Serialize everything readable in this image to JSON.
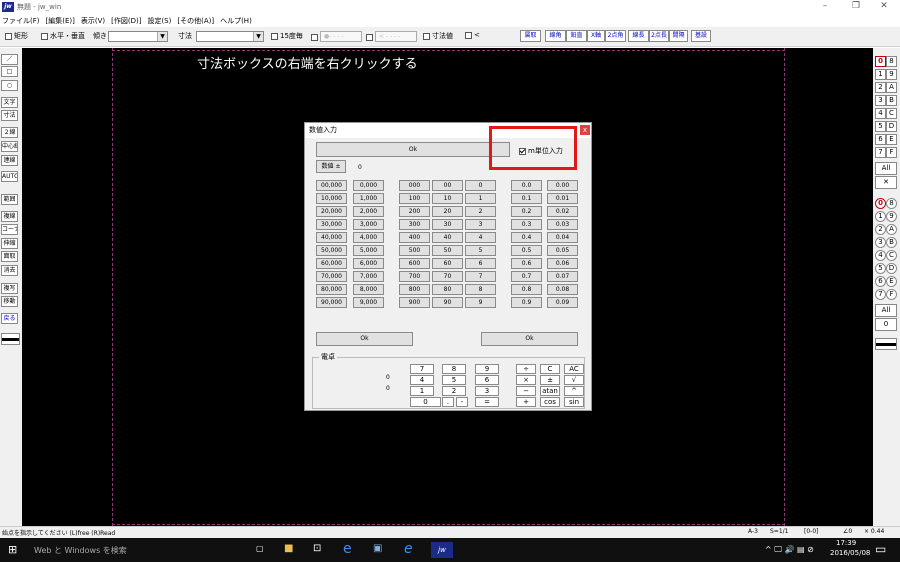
{
  "window": {
    "title": "無題 - jw_win",
    "app_icon": "jw-app-icon",
    "minimize": "–",
    "restore": "❐",
    "close": "✕"
  },
  "menu": [
    "ファイル(F)",
    "[編集(E)]",
    "表示(V)",
    "[作図(D)]",
    "設定(S)",
    "[その他(A)]",
    "ヘルプ(H)"
  ],
  "toolbar": {
    "rect_label": "矩形",
    "horiz_vert_label": "水平・垂直",
    "slope_label": "傾き",
    "slope_value": "",
    "dim_label": "寸法",
    "dim_value": "",
    "deg15_label": "15度毎",
    "linestyle_preview": "●- - - -",
    "arrow_preview": "< - - - -",
    "dimvalue_label": "寸法値",
    "lt_label": "<",
    "buttons": [
      "属取",
      "線角",
      "鉛直",
      "X軸",
      "2点角",
      "線長",
      "2点長",
      "間隔",
      "基設"
    ]
  },
  "left_tools": [
    "／",
    "□",
    "○",
    "文字",
    "寸法",
    "２線",
    "中心線",
    "連線",
    "AUTO",
    "範囲",
    "複線",
    "コーナー",
    "伸縮",
    "面取",
    "消去",
    "複写",
    "移動",
    "戻る"
  ],
  "right_layers": {
    "group1": [
      [
        "0",
        "8"
      ],
      [
        "1",
        "9"
      ],
      [
        "2",
        "A"
      ],
      [
        "3",
        "B"
      ],
      [
        "4",
        "C"
      ],
      [
        "5",
        "D"
      ],
      [
        "6",
        "E"
      ],
      [
        "7",
        "F"
      ]
    ],
    "all1": "All",
    "x1": "✕",
    "group2": [
      [
        "0",
        "8"
      ],
      [
        "1",
        "9"
      ],
      [
        "2",
        "A"
      ],
      [
        "3",
        "B"
      ],
      [
        "4",
        "C"
      ],
      [
        "5",
        "D"
      ],
      [
        "6",
        "E"
      ],
      [
        "7",
        "F"
      ]
    ],
    "all2": "All",
    "zero": "0"
  },
  "canvas": {
    "annotation": "寸法ボックスの右端を右クリックする"
  },
  "dialog": {
    "title": "数値入力",
    "close": "x",
    "ok_top": "Ok",
    "m_unit_label": "m単位入力",
    "m_unit_checked": true,
    "sign_button": "数値 ±",
    "value": "0",
    "col1": [
      "00,000",
      "10,000",
      "20,000",
      "30,000",
      "40,000",
      "50,000",
      "60,000",
      "70,000",
      "80,000",
      "90,000"
    ],
    "col2": [
      "0,000",
      "1,000",
      "2,000",
      "3,000",
      "4,000",
      "5,000",
      "6,000",
      "7,000",
      "8,000",
      "9,000"
    ],
    "col3": [
      "000",
      "100",
      "200",
      "300",
      "400",
      "500",
      "600",
      "700",
      "800",
      "900"
    ],
    "col4": [
      "00",
      "10",
      "20",
      "30",
      "40",
      "50",
      "60",
      "70",
      "80",
      "90"
    ],
    "col5": [
      "0",
      "1",
      "2",
      "3",
      "4",
      "5",
      "6",
      "7",
      "8",
      "9"
    ],
    "col6": [
      "0.0",
      "0.1",
      "0.2",
      "0.3",
      "0.4",
      "0.5",
      "0.6",
      "0.7",
      "0.8",
      "0.9"
    ],
    "col7": [
      "0.00",
      "0.01",
      "0.02",
      "0.03",
      "0.04",
      "0.05",
      "0.06",
      "0.07",
      "0.08",
      "0.09"
    ],
    "ok_left": "Ok",
    "ok_right": "Ok",
    "calc_label": "電卓",
    "calc_val1": "0",
    "calc_val2": "0",
    "calc_rows": [
      [
        "7",
        "8",
        "9",
        "÷",
        "C",
        "AC"
      ],
      [
        "4",
        "5",
        "6",
        "×",
        "±",
        "√"
      ],
      [
        "1",
        "2",
        "3",
        "−",
        "atan",
        "^"
      ],
      [
        "0",
        ".",
        "-",
        "=",
        "+",
        "cos",
        "sin"
      ]
    ]
  },
  "status": {
    "message": "始点を指示してください (L)free (R)Read",
    "paper": "A-3",
    "scale": "S=1/1",
    "layer": "[0-0]",
    "angle": "∠0",
    "ratio": "× 0.44"
  },
  "taskbar": {
    "search_placeholder": "Web と Windows を検索",
    "time": "17:39",
    "date": "2016/05/08",
    "tray": "^ 🖵 🔊 ▤ ⊘"
  }
}
